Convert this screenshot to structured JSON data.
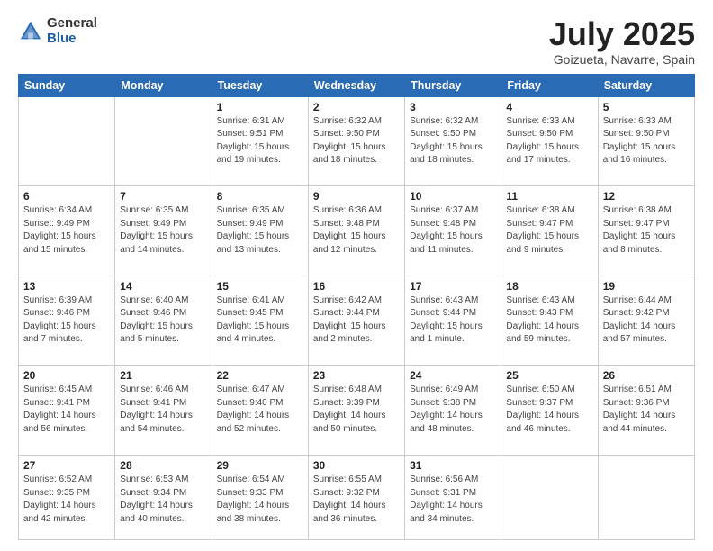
{
  "header": {
    "logo_general": "General",
    "logo_blue": "Blue",
    "month_title": "July 2025",
    "location": "Goizueta, Navarre, Spain"
  },
  "weekdays": [
    "Sunday",
    "Monday",
    "Tuesday",
    "Wednesday",
    "Thursday",
    "Friday",
    "Saturday"
  ],
  "weeks": [
    [
      {
        "day": "",
        "info": ""
      },
      {
        "day": "",
        "info": ""
      },
      {
        "day": "1",
        "info": "Sunrise: 6:31 AM\nSunset: 9:51 PM\nDaylight: 15 hours and 19 minutes."
      },
      {
        "day": "2",
        "info": "Sunrise: 6:32 AM\nSunset: 9:50 PM\nDaylight: 15 hours and 18 minutes."
      },
      {
        "day": "3",
        "info": "Sunrise: 6:32 AM\nSunset: 9:50 PM\nDaylight: 15 hours and 18 minutes."
      },
      {
        "day": "4",
        "info": "Sunrise: 6:33 AM\nSunset: 9:50 PM\nDaylight: 15 hours and 17 minutes."
      },
      {
        "day": "5",
        "info": "Sunrise: 6:33 AM\nSunset: 9:50 PM\nDaylight: 15 hours and 16 minutes."
      }
    ],
    [
      {
        "day": "6",
        "info": "Sunrise: 6:34 AM\nSunset: 9:49 PM\nDaylight: 15 hours and 15 minutes."
      },
      {
        "day": "7",
        "info": "Sunrise: 6:35 AM\nSunset: 9:49 PM\nDaylight: 15 hours and 14 minutes."
      },
      {
        "day": "8",
        "info": "Sunrise: 6:35 AM\nSunset: 9:49 PM\nDaylight: 15 hours and 13 minutes."
      },
      {
        "day": "9",
        "info": "Sunrise: 6:36 AM\nSunset: 9:48 PM\nDaylight: 15 hours and 12 minutes."
      },
      {
        "day": "10",
        "info": "Sunrise: 6:37 AM\nSunset: 9:48 PM\nDaylight: 15 hours and 11 minutes."
      },
      {
        "day": "11",
        "info": "Sunrise: 6:38 AM\nSunset: 9:47 PM\nDaylight: 15 hours and 9 minutes."
      },
      {
        "day": "12",
        "info": "Sunrise: 6:38 AM\nSunset: 9:47 PM\nDaylight: 15 hours and 8 minutes."
      }
    ],
    [
      {
        "day": "13",
        "info": "Sunrise: 6:39 AM\nSunset: 9:46 PM\nDaylight: 15 hours and 7 minutes."
      },
      {
        "day": "14",
        "info": "Sunrise: 6:40 AM\nSunset: 9:46 PM\nDaylight: 15 hours and 5 minutes."
      },
      {
        "day": "15",
        "info": "Sunrise: 6:41 AM\nSunset: 9:45 PM\nDaylight: 15 hours and 4 minutes."
      },
      {
        "day": "16",
        "info": "Sunrise: 6:42 AM\nSunset: 9:44 PM\nDaylight: 15 hours and 2 minutes."
      },
      {
        "day": "17",
        "info": "Sunrise: 6:43 AM\nSunset: 9:44 PM\nDaylight: 15 hours and 1 minute."
      },
      {
        "day": "18",
        "info": "Sunrise: 6:43 AM\nSunset: 9:43 PM\nDaylight: 14 hours and 59 minutes."
      },
      {
        "day": "19",
        "info": "Sunrise: 6:44 AM\nSunset: 9:42 PM\nDaylight: 14 hours and 57 minutes."
      }
    ],
    [
      {
        "day": "20",
        "info": "Sunrise: 6:45 AM\nSunset: 9:41 PM\nDaylight: 14 hours and 56 minutes."
      },
      {
        "day": "21",
        "info": "Sunrise: 6:46 AM\nSunset: 9:41 PM\nDaylight: 14 hours and 54 minutes."
      },
      {
        "day": "22",
        "info": "Sunrise: 6:47 AM\nSunset: 9:40 PM\nDaylight: 14 hours and 52 minutes."
      },
      {
        "day": "23",
        "info": "Sunrise: 6:48 AM\nSunset: 9:39 PM\nDaylight: 14 hours and 50 minutes."
      },
      {
        "day": "24",
        "info": "Sunrise: 6:49 AM\nSunset: 9:38 PM\nDaylight: 14 hours and 48 minutes."
      },
      {
        "day": "25",
        "info": "Sunrise: 6:50 AM\nSunset: 9:37 PM\nDaylight: 14 hours and 46 minutes."
      },
      {
        "day": "26",
        "info": "Sunrise: 6:51 AM\nSunset: 9:36 PM\nDaylight: 14 hours and 44 minutes."
      }
    ],
    [
      {
        "day": "27",
        "info": "Sunrise: 6:52 AM\nSunset: 9:35 PM\nDaylight: 14 hours and 42 minutes."
      },
      {
        "day": "28",
        "info": "Sunrise: 6:53 AM\nSunset: 9:34 PM\nDaylight: 14 hours and 40 minutes."
      },
      {
        "day": "29",
        "info": "Sunrise: 6:54 AM\nSunset: 9:33 PM\nDaylight: 14 hours and 38 minutes."
      },
      {
        "day": "30",
        "info": "Sunrise: 6:55 AM\nSunset: 9:32 PM\nDaylight: 14 hours and 36 minutes."
      },
      {
        "day": "31",
        "info": "Sunrise: 6:56 AM\nSunset: 9:31 PM\nDaylight: 14 hours and 34 minutes."
      },
      {
        "day": "",
        "info": ""
      },
      {
        "day": "",
        "info": ""
      }
    ]
  ]
}
